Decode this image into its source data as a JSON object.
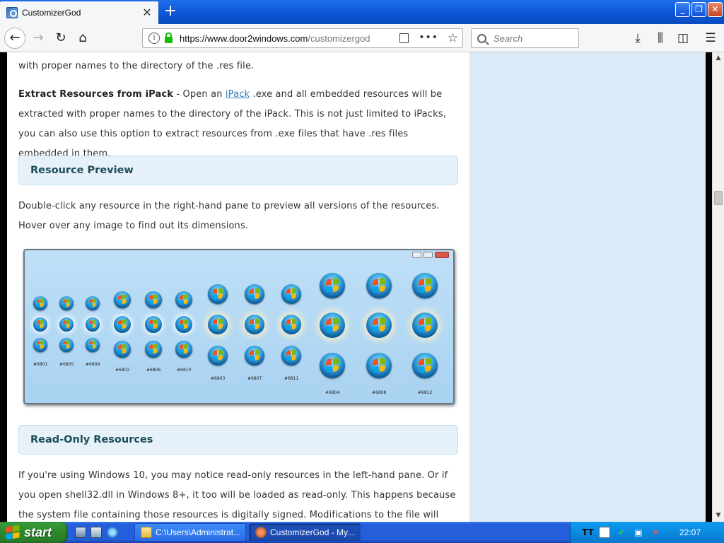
{
  "browser": {
    "tab_title": "CustomizerGod",
    "url_host": "https://www.door2windows.com",
    "url_path": "/customizergod",
    "search_placeholder": "Search"
  },
  "content": {
    "p1": "with proper names to the directory of the .res file.",
    "p2_bold": "Extract Resources from iPack",
    "p2_a": " - Open an ",
    "p2_link": "iPack",
    "p2_b": " .exe and all embedded resources will be extracted with proper names to the directory of the iPack. This is not just limited to iPacks, you can also use this option to extract resources from .exe files that have .res files embedded in them.",
    "h_preview": "Resource Preview",
    "p3": "Double-click any resource in the right-hand pane to preview all versions of the resources. Hover over any image to find out its dimensions.",
    "h_readonly": "Read-Only Resources",
    "p4": "If you're using Windows 10, you may notice read-only resources in the left-hand pane. Or if you open shell32.dll in Windows 8+, it too will be loaded as read-only. This happens because the system file containing those resources is digitally signed. Modifications to the file will break the"
  },
  "preview_labels": [
    "#6801",
    "#6805",
    "#6809",
    "#6802",
    "#6806",
    "#6810",
    "#6803",
    "#6807",
    "#6811",
    "#6804",
    "#6808",
    "#6812"
  ],
  "taskbar": {
    "start_label": "start",
    "item1": "C:\\Users\\Administrat...",
    "item2": "CustomizerGod - My...",
    "clock": "22:07",
    "tray_text": "TT"
  }
}
